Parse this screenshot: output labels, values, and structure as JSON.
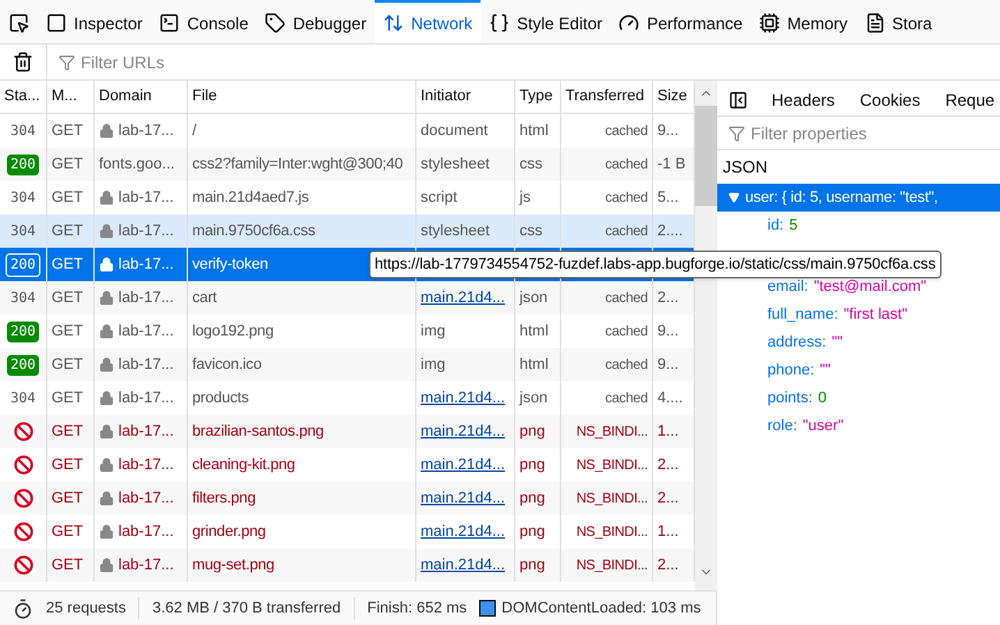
{
  "toolbar": {
    "tabs": [
      {
        "kind": "picker",
        "selected": false
      },
      {
        "kind": "inspector",
        "label": "Inspector",
        "selected": false
      },
      {
        "kind": "console",
        "label": "Console",
        "selected": false
      },
      {
        "kind": "debugger",
        "label": "Debugger",
        "selected": false
      },
      {
        "kind": "network",
        "label": "Network",
        "selected": true
      },
      {
        "kind": "style",
        "label": "Style Editor",
        "selected": false
      },
      {
        "kind": "performance",
        "label": "Performance",
        "selected": false
      },
      {
        "kind": "memory",
        "label": "Memory",
        "selected": false
      },
      {
        "kind": "storage",
        "label": "Stora",
        "selected": false
      }
    ]
  },
  "filter": {
    "placeholder": "Filter URLs"
  },
  "table": {
    "columns": [
      "Sta...",
      "M...",
      "Domain",
      "File",
      "Initiator",
      "Type",
      "Transferred",
      "Size"
    ],
    "rows": [
      {
        "kind": "plain",
        "status": "304",
        "method": "GET",
        "secure": true,
        "domain": "lab-17...",
        "file": "/",
        "initiator": "document",
        "initiator_link": false,
        "type": "html",
        "transferred": "cached",
        "size": "9...",
        "blocked": false,
        "selected": false,
        "hovered": false
      },
      {
        "kind": "badge",
        "status": "200",
        "method": "GET",
        "secure": false,
        "domain": "fonts.goo...",
        "file": "css2?family=Inter:wght@300;40",
        "initiator": "stylesheet",
        "initiator_link": false,
        "type": "css",
        "transferred": "cached",
        "size": "-1 B",
        "blocked": false,
        "selected": false,
        "hovered": false
      },
      {
        "kind": "plain",
        "status": "304",
        "method": "GET",
        "secure": true,
        "domain": "lab-17...",
        "file": "main.21d4aed7.js",
        "initiator": "script",
        "initiator_link": false,
        "type": "js",
        "transferred": "cached",
        "size": "5...",
        "blocked": false,
        "selected": false,
        "hovered": false
      },
      {
        "kind": "plain",
        "status": "304",
        "method": "GET",
        "secure": true,
        "domain": "lab-17...",
        "file": "main.9750cf6a.css",
        "initiator": "stylesheet",
        "initiator_link": false,
        "type": "css",
        "transferred": "cached",
        "size": "2....",
        "blocked": false,
        "selected": false,
        "hovered": true
      },
      {
        "kind": "badge",
        "status": "200",
        "method": "GET",
        "secure": true,
        "domain": "lab-17...",
        "file": "verify-token",
        "blocked": false,
        "selected": true,
        "hovered": false
      },
      {
        "kind": "plain",
        "status": "304",
        "method": "GET",
        "secure": true,
        "domain": "lab-17...",
        "file": "cart",
        "initiator": "main.21d4...",
        "initiator_link": true,
        "type": "json",
        "transferred": "cached",
        "size": "2...",
        "blocked": false,
        "selected": false,
        "hovered": false
      },
      {
        "kind": "badge",
        "status": "200",
        "method": "GET",
        "secure": true,
        "domain": "lab-17...",
        "file": "logo192.png",
        "initiator": "img",
        "initiator_link": false,
        "type": "html",
        "transferred": "cached",
        "size": "9...",
        "blocked": false,
        "selected": false,
        "hovered": false
      },
      {
        "kind": "badge",
        "status": "200",
        "method": "GET",
        "secure": true,
        "domain": "lab-17...",
        "file": "favicon.ico",
        "initiator": "img",
        "initiator_link": false,
        "type": "html",
        "transferred": "cached",
        "size": "9...",
        "blocked": false,
        "selected": false,
        "hovered": false
      },
      {
        "kind": "plain",
        "status": "304",
        "method": "GET",
        "secure": true,
        "domain": "lab-17...",
        "file": "products",
        "initiator": "main.21d4...",
        "initiator_link": true,
        "type": "json",
        "transferred": "cached",
        "size": "4....",
        "blocked": false,
        "selected": false,
        "hovered": false
      },
      {
        "kind": "blocked",
        "method": "GET",
        "secure": true,
        "domain": "lab-17...",
        "file": "brazilian-santos.png",
        "initiator": "main.21d4...",
        "initiator_link": true,
        "type": "png",
        "transferred": "NS_BINDI...",
        "size": "1...",
        "blocked": true,
        "selected": false,
        "hovered": false
      },
      {
        "kind": "blocked",
        "method": "GET",
        "secure": true,
        "domain": "lab-17...",
        "file": "cleaning-kit.png",
        "initiator": "main.21d4...",
        "initiator_link": true,
        "type": "png",
        "transferred": "NS_BINDI...",
        "size": "2...",
        "blocked": true,
        "selected": false,
        "hovered": false
      },
      {
        "kind": "blocked",
        "method": "GET",
        "secure": true,
        "domain": "lab-17...",
        "file": "filters.png",
        "initiator": "main.21d4...",
        "initiator_link": true,
        "type": "png",
        "transferred": "NS_BINDI...",
        "size": "2...",
        "blocked": true,
        "selected": false,
        "hovered": false
      },
      {
        "kind": "blocked",
        "method": "GET",
        "secure": true,
        "domain": "lab-17...",
        "file": "grinder.png",
        "initiator": "main.21d4...",
        "initiator_link": true,
        "type": "png",
        "transferred": "NS_BINDI...",
        "size": "1...",
        "blocked": true,
        "selected": false,
        "hovered": false
      },
      {
        "kind": "blocked",
        "method": "GET",
        "secure": true,
        "domain": "lab-17...",
        "file": "mug-set.png",
        "initiator": "main.21d4...",
        "initiator_link": true,
        "type": "png",
        "transferred": "NS_BINDI...",
        "size": "2...",
        "blocked": true,
        "selected": false,
        "hovered": false
      }
    ]
  },
  "tooltip": "https://lab-1779734554752-fuzdef.labs-app.bugforge.io/static/css/main.9750cf6a.css",
  "status_bar": {
    "requests": "25 requests",
    "transferred": "3.62 MB / 370 B transferred",
    "finish": "Finish: 652 ms",
    "dom_content_loaded": "DOMContentLoaded: 103 ms"
  },
  "side_panel": {
    "tabs": [
      {
        "label": "Headers",
        "selected": false
      },
      {
        "label": "Cookies",
        "selected": false
      },
      {
        "label": "Reque",
        "selected": false
      }
    ],
    "filter": {
      "placeholder": "Filter properties"
    },
    "section": "JSON",
    "tree": {
      "label": "user: { id: 5, username: \"test\",",
      "expanded": true,
      "selected": true,
      "children": [
        {
          "key": "id:",
          "value": "5",
          "kind": "number"
        },
        {
          "key": "email:",
          "value": "\"test@mail.com\"",
          "kind": "string"
        },
        {
          "key": "full_name:",
          "value": "\"first last\"",
          "kind": "string"
        },
        {
          "key": "address:",
          "value": "\"\"",
          "kind": "string"
        },
        {
          "key": "phone:",
          "value": "\"\"",
          "kind": "string"
        },
        {
          "key": "points:",
          "value": "0",
          "kind": "number"
        },
        {
          "key": "role:",
          "value": "\"user\"",
          "kind": "string"
        }
      ]
    }
  }
}
